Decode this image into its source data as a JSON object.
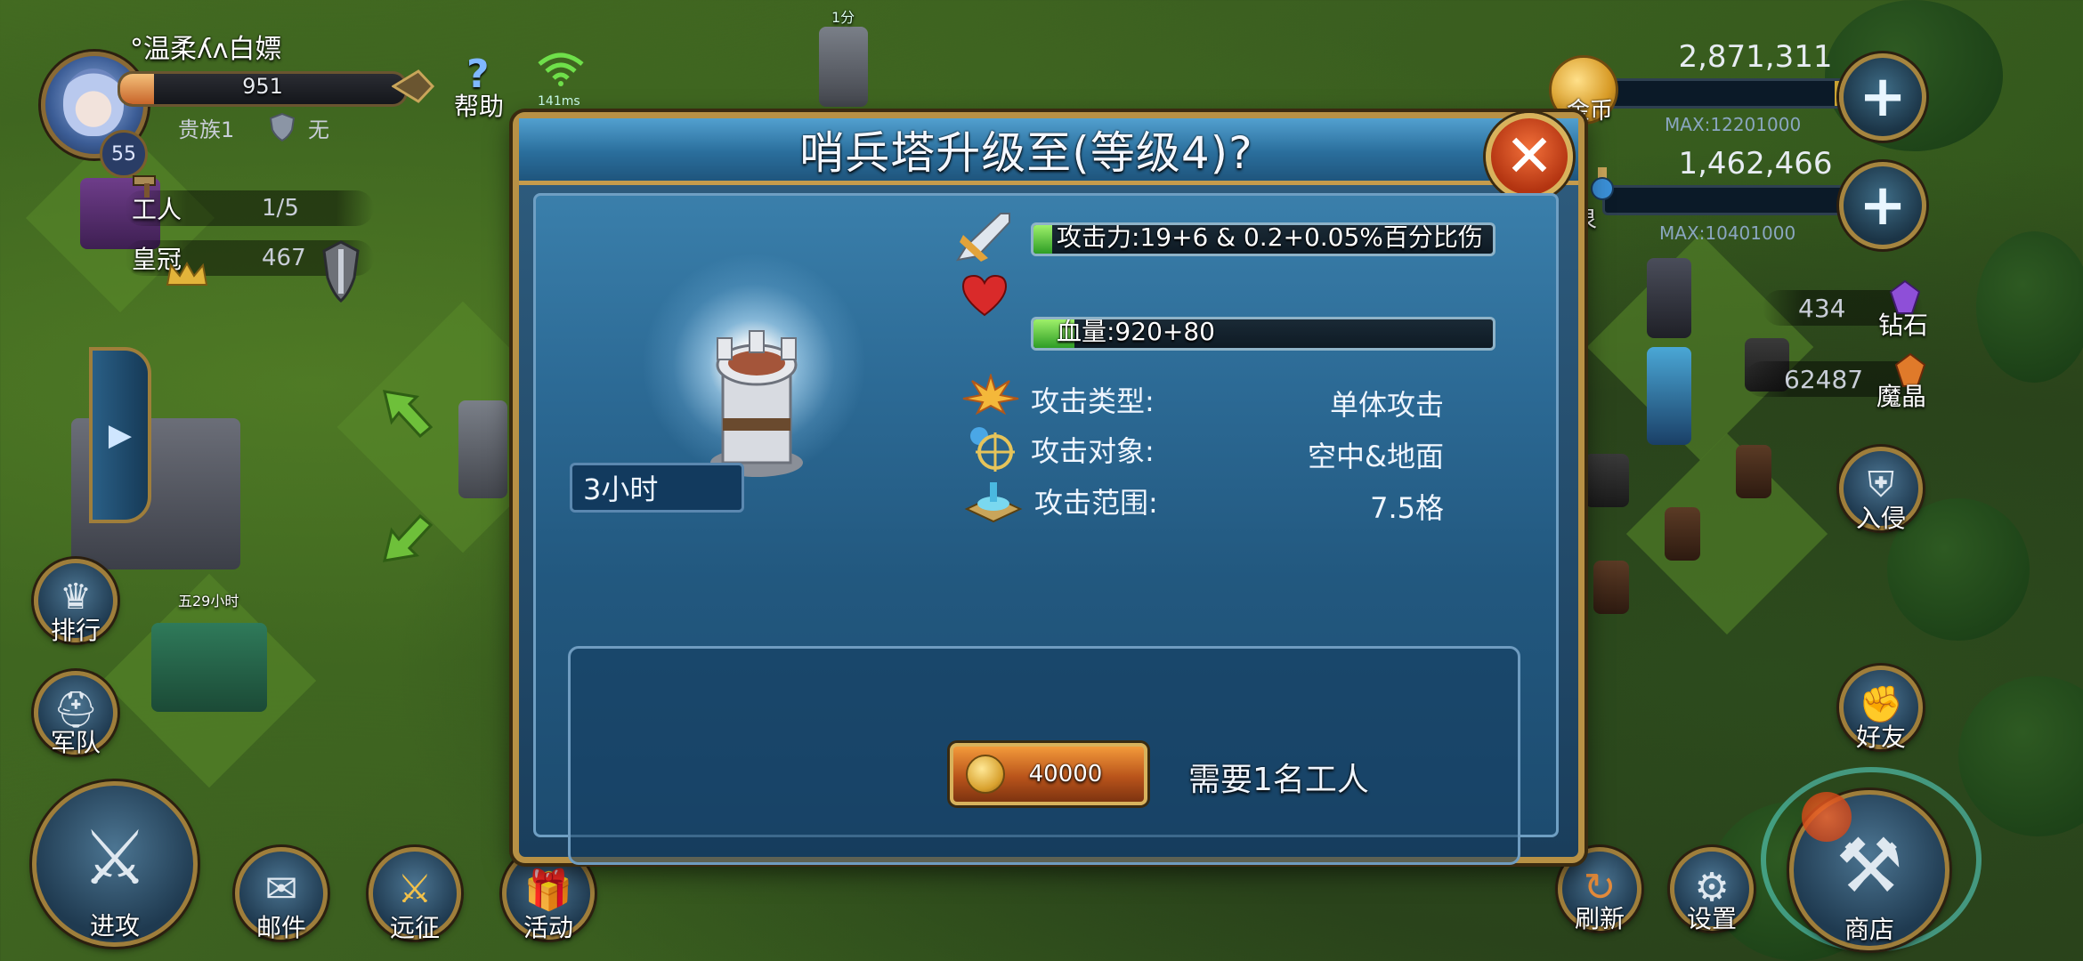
{
  "player": {
    "name": "°温柔ʎʌ白嫖",
    "level": "55",
    "hp_value": "951",
    "hp_fraction": 0.12,
    "rank": "贵族1",
    "guild": "无",
    "workers_label": "工人",
    "workers_value": "1/5",
    "crown_label": "皇冠",
    "crown_value": "467"
  },
  "top_icons": {
    "help_label": "帮助",
    "ping_text": "141ms"
  },
  "resources": {
    "gold": {
      "label": "金币",
      "value": "2,871,311",
      "max": "MAX:12201000",
      "fill": 0.16,
      "color": "#c9a232"
    },
    "elixir": {
      "label": "泉",
      "value": "1,462,466",
      "max": "MAX:10401000",
      "fill": 0.1,
      "color": "#2f8fcf"
    },
    "diamond": {
      "label": "钻石",
      "value": "434"
    },
    "crystal": {
      "label": "魔晶",
      "value": "62487"
    }
  },
  "right_menu": {
    "invade": "入侵",
    "friends": "好友",
    "refresh": "刷新",
    "settings": "设置",
    "shop": "商店"
  },
  "left_menu": {
    "ranking": "排行",
    "army": "军队",
    "attack": "进攻",
    "mail": "邮件",
    "expedition": "远征",
    "events": "活动"
  },
  "dialog": {
    "title": "哨兵塔升级至(等级4)?",
    "close": "✕",
    "build_time": "3小时",
    "stats": [
      {
        "label": "攻击力:19+6 & 0.2+0.05%百分比伤害",
        "fill": 0.04,
        "icon": "sword-icon"
      },
      {
        "label": "血量:920+80",
        "fill": 0.09,
        "icon": "heart-icon"
      }
    ],
    "attributes": [
      {
        "label": "攻击类型:",
        "value": "单体攻击",
        "icon": "burst-icon"
      },
      {
        "label": "攻击对象:",
        "value": "空中&地面",
        "icon": "target-icon"
      },
      {
        "label": "攻击范围:",
        "value": "7.5格",
        "icon": "range-icon"
      }
    ],
    "cost": "40000",
    "requirement": "需要1名工人"
  },
  "scenery": {
    "tower_timer": "1分",
    "hut_timer": "五29小时"
  }
}
